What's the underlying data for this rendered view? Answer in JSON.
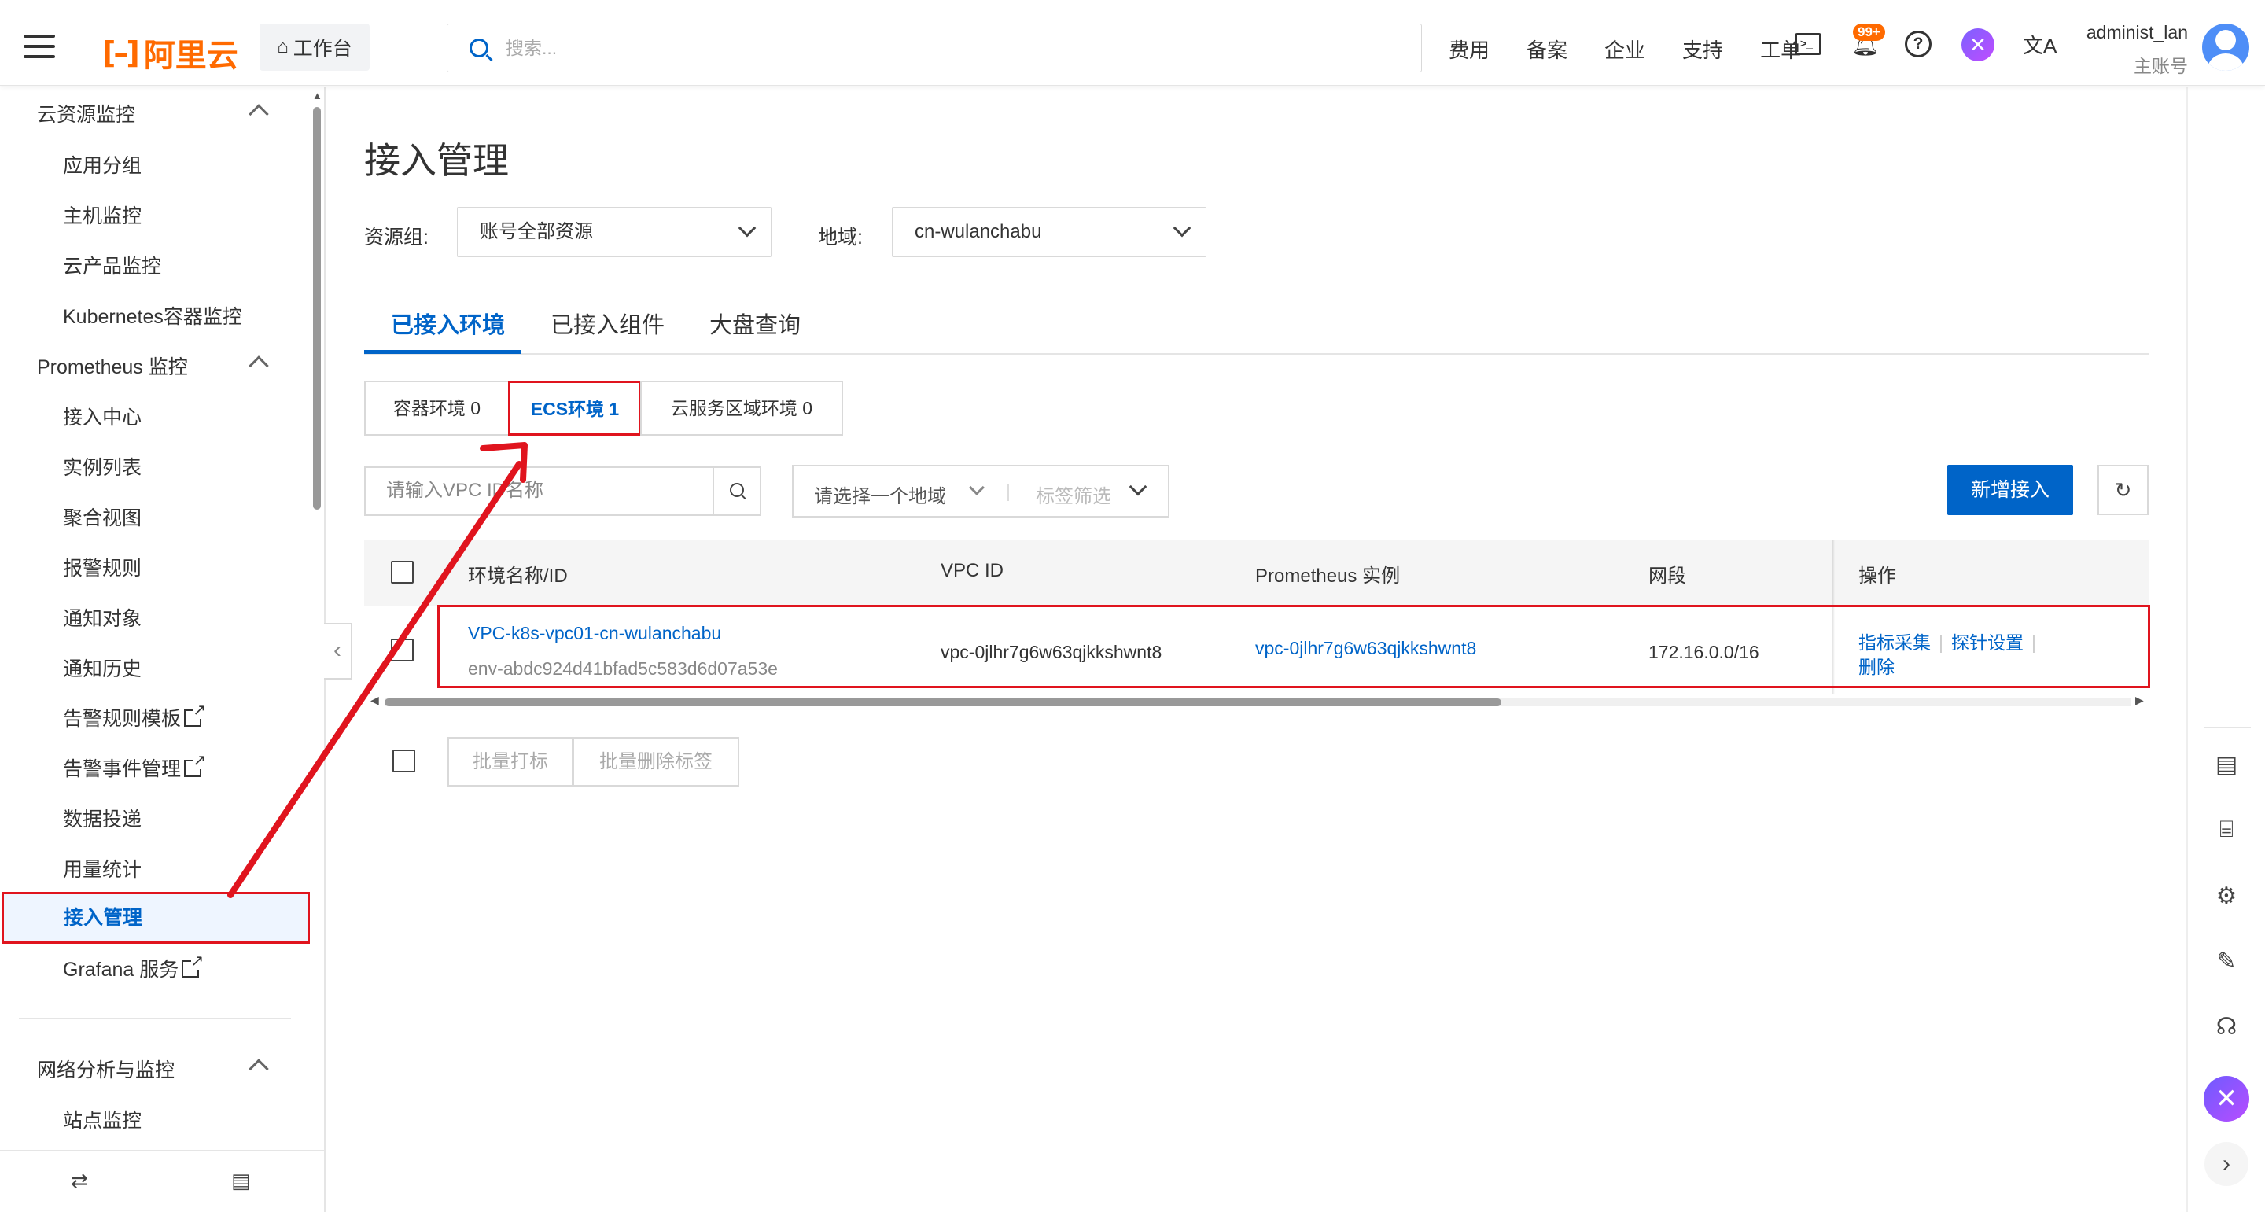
{
  "topbar": {
    "logo_text": "阿里云",
    "workbench": "工作台",
    "search_placeholder": "搜索...",
    "nav": [
      "费用",
      "备案",
      "企业",
      "支持",
      "工单"
    ],
    "notification_badge": "99+",
    "user_name": "administ_lan",
    "user_role": "主账号"
  },
  "sidebar": {
    "groups": [
      {
        "title": "云资源监控",
        "items": [
          "应用分组",
          "主机监控",
          "云产品监控",
          "Kubernetes容器监控"
        ]
      },
      {
        "title": "Prometheus 监控",
        "items": [
          "接入中心",
          "实例列表",
          "聚合视图",
          "报警规则",
          "通知对象",
          "通知历史",
          "告警规则模板",
          "告警事件管理",
          "数据投递",
          "用量统计",
          "接入管理",
          "Grafana 服务"
        ]
      },
      {
        "title": "网络分析与监控",
        "items": [
          "站点监控"
        ]
      }
    ],
    "active_item": "接入管理"
  },
  "main": {
    "title": "接入管理",
    "resource_group_label": "资源组:",
    "resource_group_value": "账号全部资源",
    "region_label": "地域:",
    "region_value": "cn-wulanchabu",
    "tabs": [
      "已接入环境",
      "已接入组件",
      "大盘查询"
    ],
    "active_tab": "已接入环境",
    "env_segments": [
      "容器环境 0",
      "ECS环境 1",
      "云服务区域环境 0"
    ],
    "active_segment": "ECS环境 1",
    "vpc_search_placeholder": "请输入VPC ID名称",
    "region_filter_placeholder": "请选择一个地域",
    "tag_filter_placeholder": "标签筛选",
    "add_button": "新增接入",
    "table": {
      "columns": [
        "环境名称/ID",
        "VPC ID",
        "Prometheus 实例",
        "网段",
        "操作"
      ],
      "rows": [
        {
          "env_name": "VPC-k8s-vpc01-cn-wulanchabu",
          "env_id": "env-abdc924d41bfad5c583d6d07a53e",
          "vpc_id": "vpc-0jlhr7g6w63qjkkshwnt8",
          "prometheus_instance": "vpc-0jlhr7g6w63qjkkshwnt8",
          "cidr": "172.16.0.0/16",
          "actions": [
            "指标采集",
            "探针设置",
            "删除"
          ]
        }
      ]
    },
    "bulk_tag_button": "批量打标",
    "bulk_untag_button": "批量删除标签"
  },
  "colors": {
    "primary": "#0064c8",
    "brand": "#ff6a00",
    "annotation": "#e0141e"
  }
}
